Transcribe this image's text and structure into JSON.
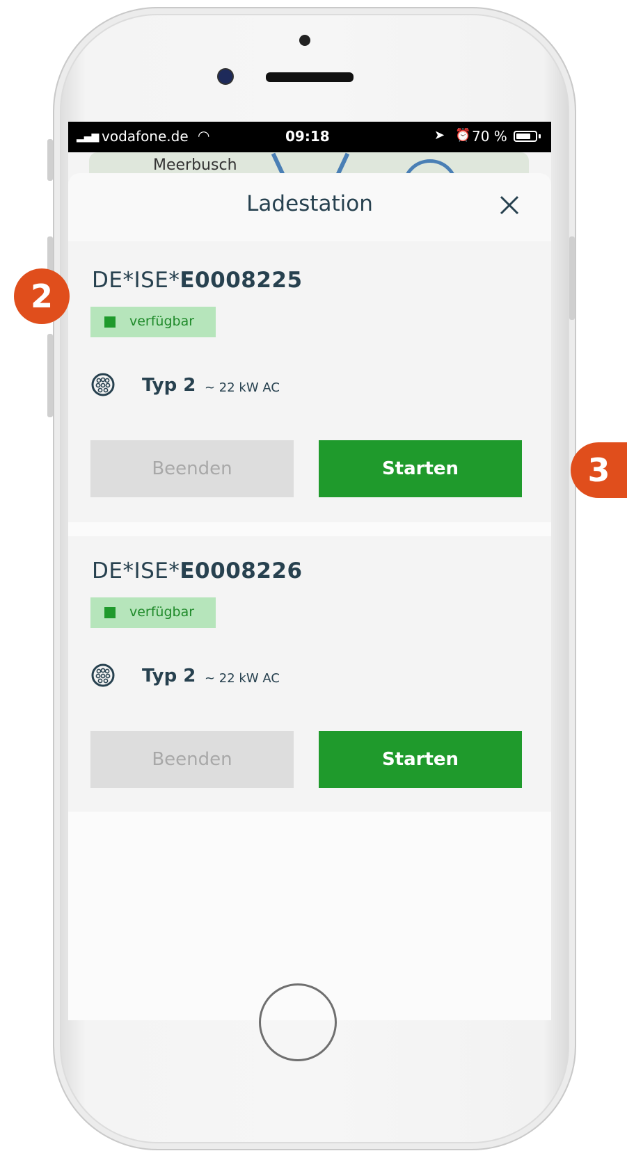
{
  "status_bar": {
    "carrier": "vodafone.de",
    "time": "09:18",
    "battery": "70 %"
  },
  "map": {
    "place_label": "Meerbusch"
  },
  "sheet": {
    "title": "Ladestation"
  },
  "stations": [
    {
      "id_prefix": "DE*ISE*",
      "id_code": "E0008225",
      "status": "verfügbar",
      "connector_type": "Typ 2",
      "connector_power": "~ 22 kW AC",
      "stop_label": "Beenden",
      "start_label": "Starten"
    },
    {
      "id_prefix": "DE*ISE*",
      "id_code": "E0008226",
      "status": "verfügbar",
      "connector_type": "Typ 2",
      "connector_power": "~ 22 kW AC",
      "stop_label": "Beenden",
      "start_label": "Starten"
    }
  ],
  "callouts": {
    "first": "2",
    "second": "3"
  },
  "colors": {
    "primary_green": "#1f9a2c",
    "status_badge_bg": "#b6e5bb",
    "text_dark": "#27414f",
    "callout_orange": "#e04e1c",
    "disabled_button": "#dddddd"
  }
}
